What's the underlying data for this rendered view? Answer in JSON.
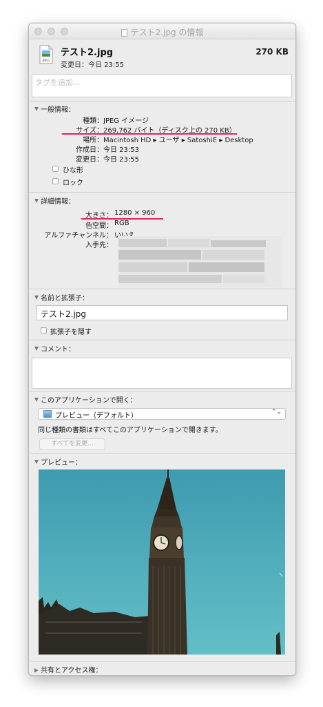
{
  "window": {
    "title": "テスト2.jpg の情報"
  },
  "header": {
    "icon_label": "JPEG",
    "file_name": "テスト2.jpg",
    "size": "270 KB",
    "modified": "変更日：今日 23:55"
  },
  "tags": {
    "placeholder": "タグを追加..."
  },
  "general": {
    "title": "一般情報：",
    "rows": [
      {
        "label": "種類：",
        "value": "JPEG イメージ"
      },
      {
        "label": "サイズ：",
        "value": "269,762 バイト（ディスク上の 270 KB）"
      },
      {
        "label": "場所：",
        "value": "Macintosh HD ▸ ユーザ ▸ SatoshiE ▸ Desktop"
      },
      {
        "label": "作成日：",
        "value": "今日 23:53"
      },
      {
        "label": "変更日：",
        "value": "今日 23:55"
      }
    ],
    "stationery_label": "ひな形",
    "locked_label": "ロック"
  },
  "more_info": {
    "title": "詳細情報：",
    "rows": [
      {
        "label": "大きさ：",
        "value": "1280 × 960"
      },
      {
        "label": "色空間：",
        "value": "RGB"
      },
      {
        "label": "アルファチャンネル：",
        "value": "いいえ"
      },
      {
        "label": "入手先：",
        "value": ""
      }
    ]
  },
  "name_ext": {
    "title": "名前と拡張子：",
    "value": "テスト2.jpg",
    "hide_ext_label": "拡張子を隠す"
  },
  "comments": {
    "title": "コメント："
  },
  "open_with": {
    "title": "このアプリケーションで開く：",
    "app": "プレビュー（デフォルト）",
    "note": "同じ種類の書類はすべてこのアプリケーションで開きます。",
    "change_all": "すべてを変更..."
  },
  "preview": {
    "title": "プレビュー："
  },
  "sharing": {
    "title": "共有とアクセス権："
  },
  "colors": {
    "highlight": "#e0245e",
    "sky": "#3d9fb0"
  }
}
